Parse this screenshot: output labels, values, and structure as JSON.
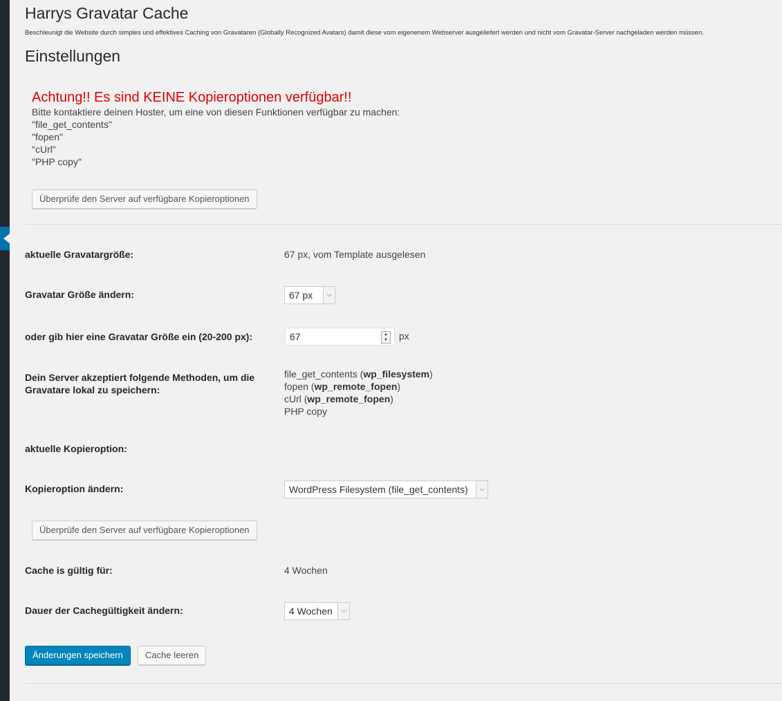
{
  "header": {
    "title": "Harrys Gravatar Cache",
    "description": "Beschleunigt die Website durch simples und effektives Caching von Gravataren (Globally Recognized Avatars) damit diese vom eigenenem Webserver ausgeliefert werden und nicht vom Gravatar-Server nachgeladen werden müssen.",
    "section_title": "Einstellungen"
  },
  "warning": {
    "title": "Achtung!! Es sind KEINE Kopieroptionen verfügbar!!",
    "text": "Bitte kontaktiere deinen Hoster, um eine von diesen Funktionen verfügbar zu machen:",
    "functions": [
      "\"file_get_contents\"",
      "\"fopen\"",
      "\"cUrl\"",
      "\"PHP copy\""
    ],
    "check_button": "Überprüfe den Server auf verfügbare Kopieroptionen"
  },
  "settings": {
    "current_size_label": "aktuelle Gravatargröße:",
    "current_size_value": "67 px, vom Template ausgelesen",
    "change_size_label": "Gravatar Größe ändern:",
    "change_size_selected": "67 px",
    "custom_size_label": "oder gib hier eine Gravatar Größe ein (20-200 px):",
    "custom_size_value": "67",
    "custom_size_unit": "px",
    "methods_label": "Dein Server akzeptiert folgende Methoden, um die Gravatare lokal zu speichern:",
    "methods": [
      {
        "name": "file_get_contents",
        "via": "wp_filesystem"
      },
      {
        "name": "fopen",
        "via": "wp_remote_fopen"
      },
      {
        "name": "cUrl",
        "via": "wp_remote_fopen"
      },
      {
        "name": "PHP copy",
        "via": ""
      }
    ],
    "current_copy_label": "aktuelle Kopieroption:",
    "current_copy_value": "",
    "change_copy_label": "Kopieroption ändern:",
    "change_copy_selected": "WordPress Filesystem (file_get_contents)",
    "check_button": "Überprüfe den Server auf verfügbare Kopieroptionen",
    "cache_valid_label": "Cache is gültig für:",
    "cache_valid_value": "4 Wochen",
    "change_cache_label": "Dauer der Cachegültigkeit ändern:",
    "change_cache_selected": "4 Wochen"
  },
  "actions": {
    "save_label": "Änderungen speichern",
    "clear_label": "Cache leeren"
  },
  "colors": {
    "warning": "#e00000",
    "primary": "#0085ba",
    "admin_bar": "#23282d",
    "admin_current": "#0073aa"
  }
}
